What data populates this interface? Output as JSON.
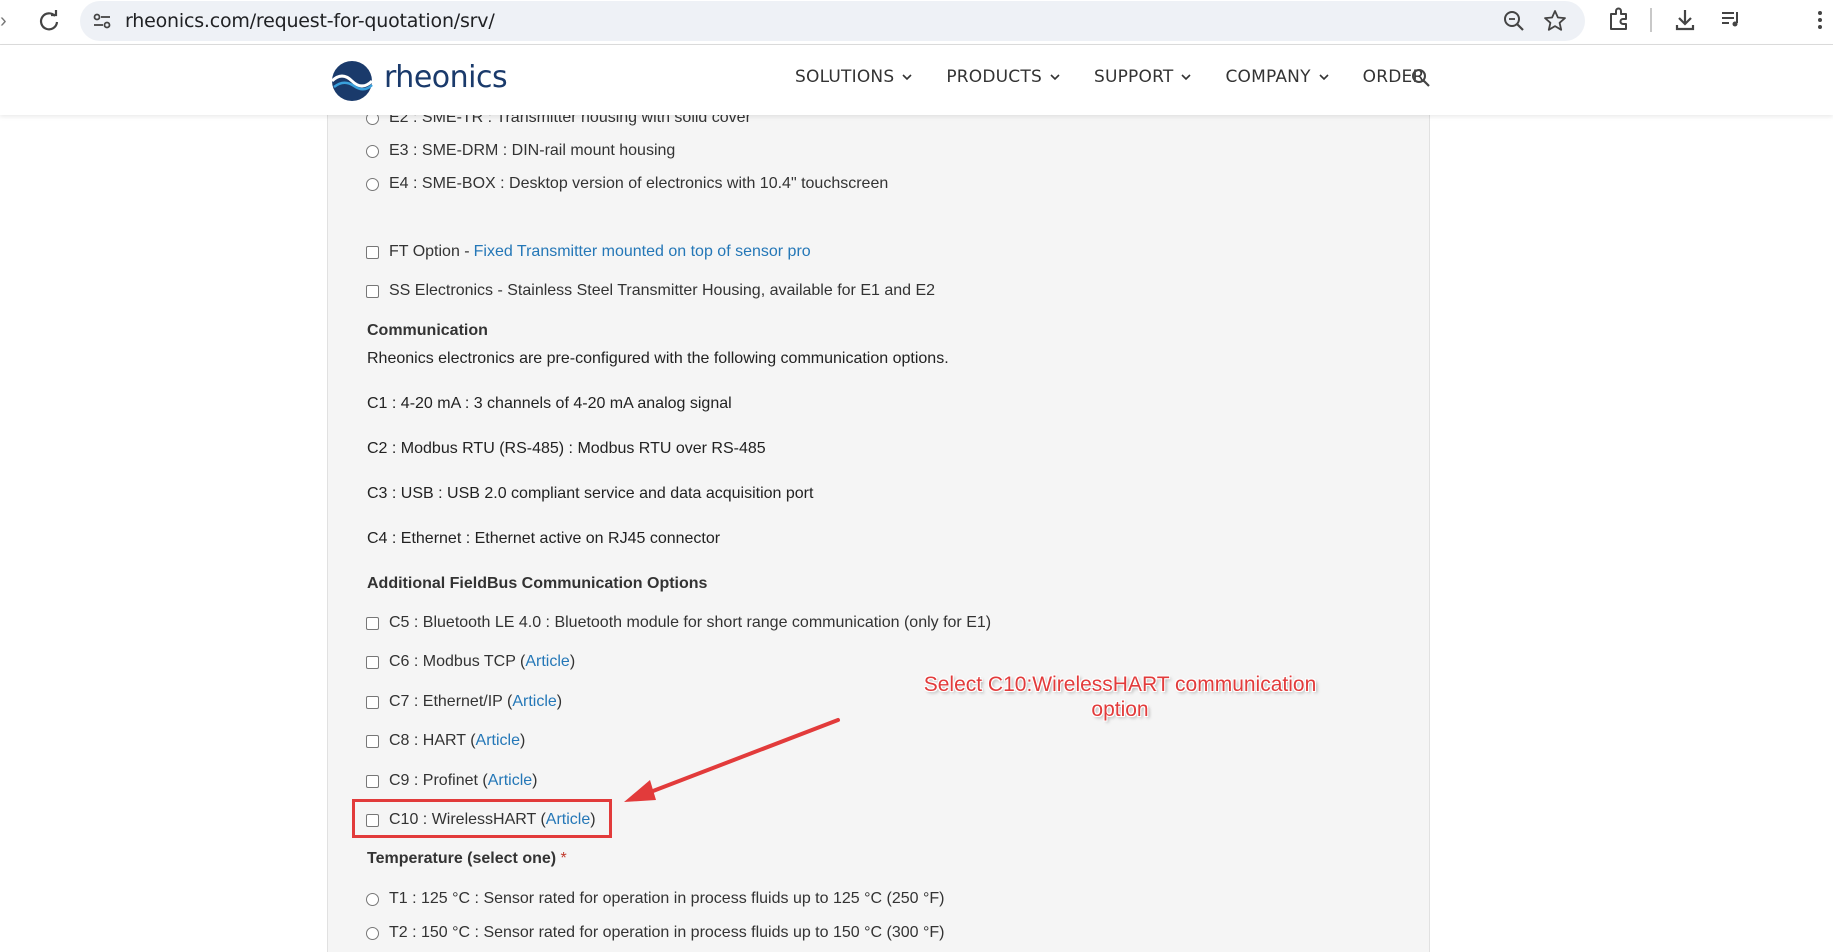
{
  "browser": {
    "url": "rheonics.com/request-for-quotation/srv/"
  },
  "header": {
    "logo_text": "rheonics",
    "nav": [
      "SOLUTIONS",
      "PRODUCTS",
      "SUPPORT",
      "COMPANY",
      "ORDER"
    ]
  },
  "form": {
    "electronics_options": [
      "E2 : SME-TR : Transmitter housing with solid cover",
      "E3 : SME-DRM : DIN-rail mount housing",
      "E4 : SME-BOX : Desktop version of electronics with 10.4\" touchscreen"
    ],
    "ft_option": {
      "prefix": "FT Option - ",
      "link": "Fixed Transmitter mounted on top of sensor pro"
    },
    "ss_electronics": "SS Electronics - Stainless Steel Transmitter Housing, available for E1 and E2",
    "communication_heading": "Communication",
    "communication_intro": "Rheonics electronics are pre-configured with the following communication options.",
    "communication_items": [
      "C1 : 4-20 mA : 3 channels of 4-20 mA analog signal",
      "C2 : Modbus RTU (RS-485) : Modbus RTU over RS-485",
      "C3 : USB : USB 2.0 compliant service and data acquisition port",
      "C4 : Ethernet : Ethernet active on RJ45 connector"
    ],
    "fieldbus_heading": "Additional FieldBus Communication Options",
    "c5": "C5 : Bluetooth LE 4.0 : Bluetooth module for short range communication (only for E1)",
    "fieldbus_options": [
      {
        "label": "C6 : Modbus TCP (",
        "link": "Article",
        "suffix": ")"
      },
      {
        "label": "C7 : Ethernet/IP (",
        "link": "Article",
        "suffix": ")"
      },
      {
        "label": "C8 : HART (",
        "link": "Article",
        "suffix": ")"
      },
      {
        "label": "C9 : Profinet (",
        "link": "Article",
        "suffix": ")"
      },
      {
        "label": "C10 : WirelessHART (",
        "link": "Article",
        "suffix": ")"
      }
    ],
    "temperature_heading": "Temperature (select one)",
    "required_mark": "*",
    "temperature_options": [
      "T1 : 125 °C : Sensor rated for operation in process fluids up to 125 °C (250 °F)",
      "T2 : 150 °C : Sensor rated for operation in process fluids up to 150 °C (300 °F)"
    ]
  },
  "annotation": {
    "line1": "Select C10:WirelessHART communication",
    "line2": "option",
    "color": "#e23b3b"
  },
  "colors": {
    "link": "#2477b7",
    "brand": "#1a3a6b"
  }
}
